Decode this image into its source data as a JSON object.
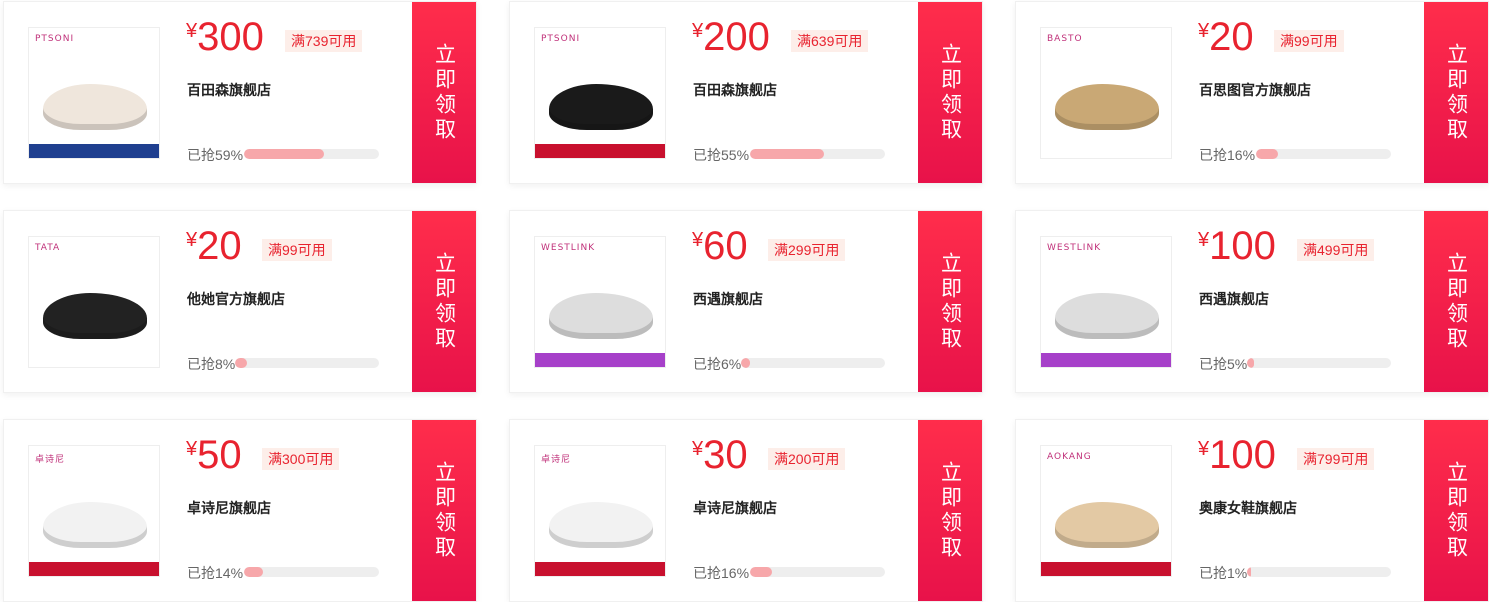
{
  "coupons": [
    {
      "amount": "300",
      "cond": "满739可用",
      "shop": "百田森旗舰店",
      "grab": "已抢59%",
      "progress": 0.59,
      "brand": "PTSONI",
      "shoe_color": "#efe6dc",
      "promo_color": "#1f3f8f"
    },
    {
      "amount": "200",
      "cond": "满639可用",
      "shop": "百田森旗舰店",
      "grab": "已抢55%",
      "progress": 0.55,
      "brand": "PTSONI",
      "shoe_color": "#1a1a1a",
      "promo_color": "#c8102e"
    },
    {
      "amount": "20",
      "cond": "满99可用",
      "shop": "百思图官方旗舰店",
      "grab": "已抢16%",
      "progress": 0.16,
      "brand": "BASTO",
      "shoe_color": "#c9a875",
      "promo_color": ""
    },
    {
      "amount": "20",
      "cond": "满99可用",
      "shop": "他她官方旗舰店",
      "grab": "已抢8%",
      "progress": 0.08,
      "brand": "TATA",
      "shoe_color": "#222222",
      "promo_color": ""
    },
    {
      "amount": "60",
      "cond": "满299可用",
      "shop": "西遇旗舰店",
      "grab": "已抢6%",
      "progress": 0.06,
      "brand": "WESTLINK",
      "shoe_color": "#dddddd",
      "promo_color": "#a640c9"
    },
    {
      "amount": "100",
      "cond": "满499可用",
      "shop": "西遇旗舰店",
      "grab": "已抢5%",
      "progress": 0.05,
      "brand": "WESTLINK",
      "shoe_color": "#dddddd",
      "promo_color": "#a640c9"
    },
    {
      "amount": "50",
      "cond": "满300可用",
      "shop": "卓诗尼旗舰店",
      "grab": "已抢14%",
      "progress": 0.14,
      "brand": "卓诗尼",
      "shoe_color": "#f2f2f2",
      "promo_color": "#c8102e"
    },
    {
      "amount": "30",
      "cond": "满200可用",
      "shop": "卓诗尼旗舰店",
      "grab": "已抢16%",
      "progress": 0.16,
      "brand": "卓诗尼",
      "shoe_color": "#f2f2f2",
      "promo_color": "#c8102e"
    },
    {
      "amount": "100",
      "cond": "满799可用",
      "shop": "奥康女鞋旗舰店",
      "grab": "已抢1%",
      "progress": 0.01,
      "brand": "AOKANG",
      "shoe_color": "#e3c9a4",
      "promo_color": "#c8102e"
    }
  ],
  "currency_symbol": "¥",
  "claim_label": "立即领取",
  "colors": {
    "accent": "#e8232f",
    "claim_bg": "#ff2d4b",
    "progress_fill": "#f7a7aa"
  }
}
